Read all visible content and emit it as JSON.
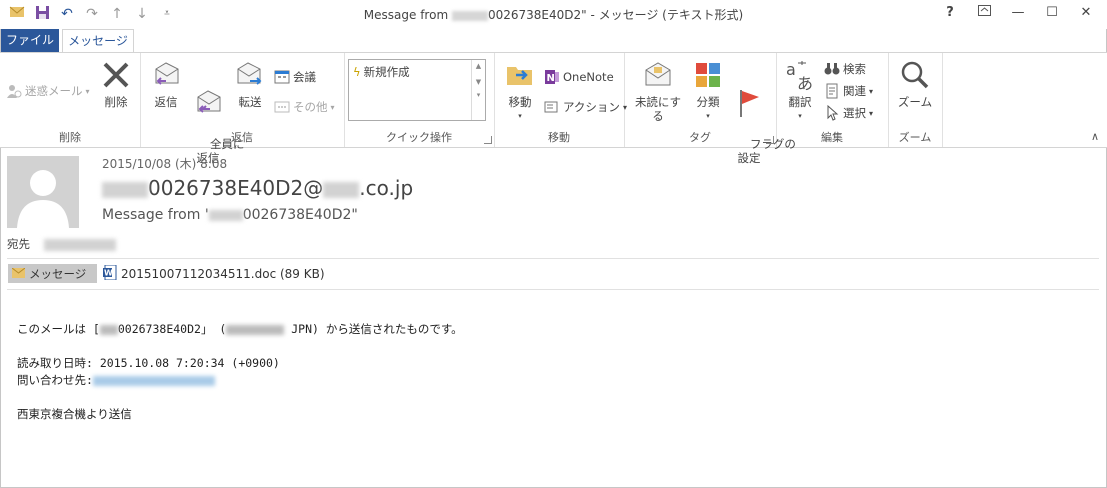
{
  "window": {
    "title_prefix": "Message from ",
    "title_suffix": "0026738E40D2\" - メッセージ (テキスト形式)",
    "help": "?"
  },
  "tabs": {
    "file": "ファイル",
    "message": "メッセージ"
  },
  "ribbon": {
    "delete_group": {
      "label": "削除",
      "junk": "迷惑メール",
      "delete": "削除"
    },
    "respond_group": {
      "label": "返信",
      "reply": "返信",
      "reply_all": "全員に\n返信",
      "forward": "転送",
      "meeting": "会議",
      "more": "その他"
    },
    "quick_group": {
      "label": "クイック操作",
      "new": "新規作成"
    },
    "move_group": {
      "label": "移動",
      "move": "移動",
      "onenote": "OneNote",
      "actions": "アクション"
    },
    "tags_group": {
      "label": "タグ",
      "unread": "未読にする",
      "categorize": "分類",
      "followup": "フラグの\n設定"
    },
    "edit_group": {
      "label": "編集",
      "translate": "翻訳",
      "find": "検索",
      "related": "関連",
      "select": "選択"
    },
    "zoom_group": {
      "label": "ズーム",
      "zoom": "ズーム"
    }
  },
  "header": {
    "date": "2015/10/08 (木) 8:08",
    "sender_mid": "0026738E40D2@",
    "sender_end": ".co.jp",
    "subject_prefix": "Message from '",
    "subject_suffix": "0026738E40D2\"",
    "to_label": "宛先"
  },
  "attachments": {
    "message_tab": "メッセージ",
    "file": "20151007112034511.doc (89 KB)"
  },
  "body": {
    "line1_a": "このメールは [",
    "line1_b": "0026738E40D2」 (",
    "line1_c": " JPN) から送信されたものです。",
    "line2": "読み取り日時: 2015.10.08 7:20:34 (+0900)",
    "line3": "問い合わせ先:",
    "line4": "西東京複合機より送信"
  },
  "colors": {
    "accent": "#2b579a",
    "flag": "#e04b3c"
  }
}
